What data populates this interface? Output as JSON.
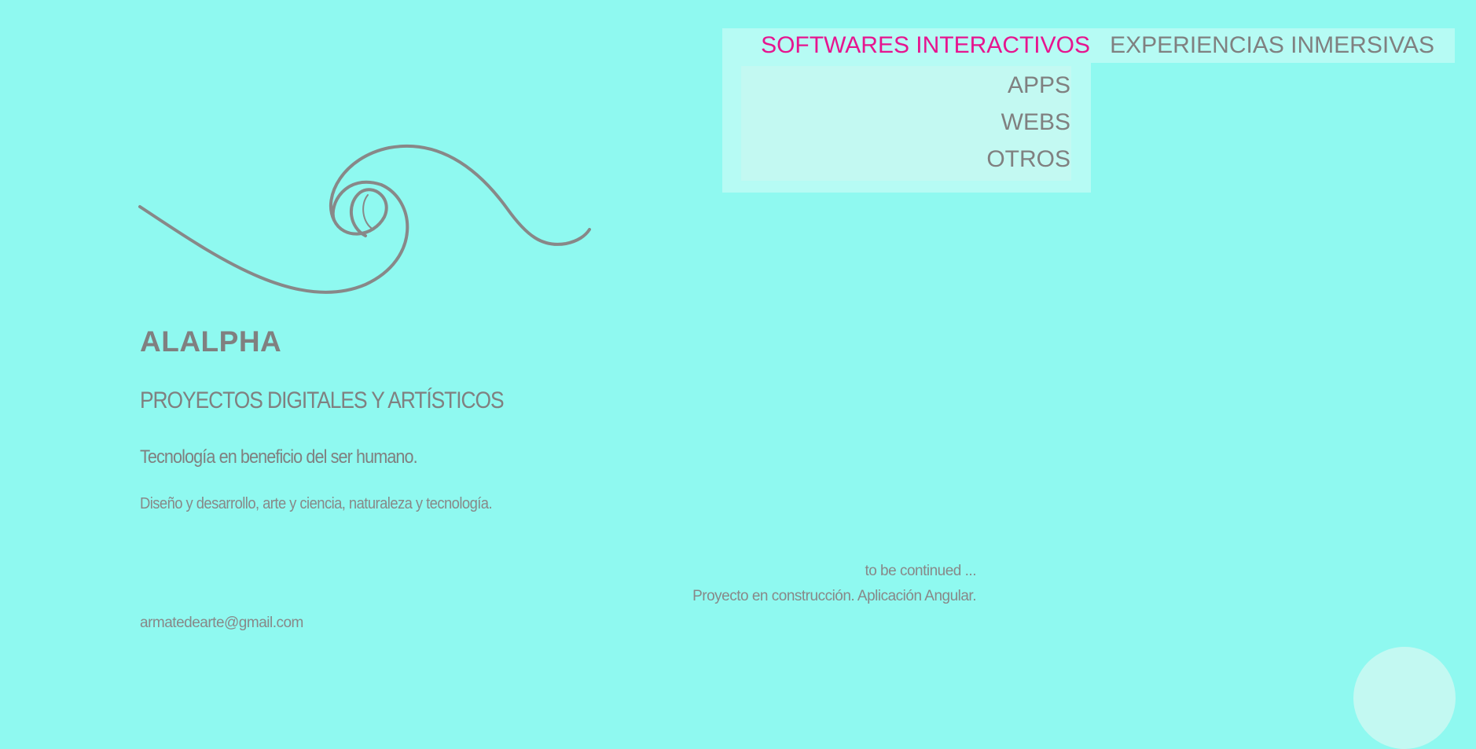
{
  "nav": {
    "items": [
      {
        "label": "SOFTWARES INTERACTIVOS",
        "active": true
      },
      {
        "label": "EXPERIENCIAS INMERSIVAS",
        "active": false
      }
    ],
    "dropdown": [
      "APPS",
      "WEBS",
      "OTROS"
    ],
    "active_color": "#e6158f",
    "background_color": "#b6fbf4"
  },
  "hero": {
    "logo_icon": "spiral-wave-logo",
    "brand": "ALALPHA",
    "subtitle": "PROYECTOS DIGITALES Y ARTÍSTICOS",
    "tagline": "Tecnología en beneficio del ser humano.",
    "description": "Diseño y desarrollo, arte y ciencia, naturaleza y tecnología."
  },
  "footer": {
    "to_be_continued": "to be continued ...",
    "construction_note": "Proyecto en construcción. Aplicación Angular.",
    "email": "armatedearte@gmail.com"
  },
  "theme": {
    "page_background": "#8ff9f0",
    "text_color": "#888888"
  }
}
